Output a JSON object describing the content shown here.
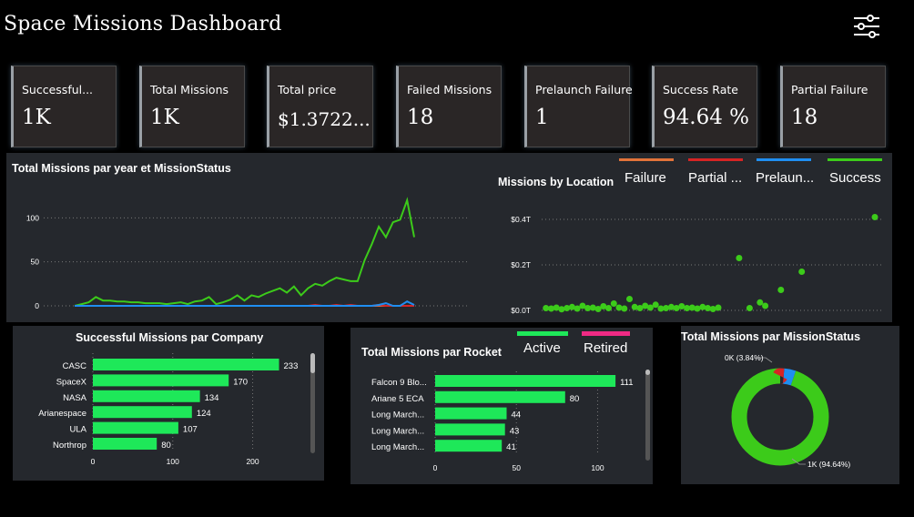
{
  "header": {
    "title": "Space Missions Dashboard",
    "filter_icon": "sliders-icon"
  },
  "kpis": [
    {
      "label": "Successful...",
      "value": "1K"
    },
    {
      "label": "Total Missions",
      "value": "1K"
    },
    {
      "label": "Total price",
      "value": "$1.3722..."
    },
    {
      "label": "Failed Missions",
      "value": "18"
    },
    {
      "label": "Prelaunch Failure",
      "value": "1"
    },
    {
      "label": "Success Rate",
      "value": "94.64 %"
    },
    {
      "label": "Partial Failure",
      "value": "18"
    }
  ],
  "status_legend": [
    {
      "label": "Failure",
      "color": "#e2733a"
    },
    {
      "label": "Partial ...",
      "color": "#d62424"
    },
    {
      "label": "Prelaun...",
      "color": "#1f8ef1"
    },
    {
      "label": "Success",
      "color": "#3ccb1a"
    }
  ],
  "rocket_legend": [
    {
      "label": "Active",
      "color": "#1ee859"
    },
    {
      "label": "Retired",
      "color": "#ef2a84"
    }
  ],
  "line_panel": {
    "title": "Total Missions par year et MissionStatus"
  },
  "location_panel": {
    "title": "Missions by Location"
  },
  "company_panel": {
    "title": "Successful Missions par Company"
  },
  "rocket_panel": {
    "title": "Total Missions par Rocket"
  },
  "status_panel": {
    "title": "Total Missions par MissionStatus"
  },
  "chart_data": [
    {
      "type": "line",
      "title": "Total Missions par year et MissionStatus",
      "ylim": [
        0,
        120
      ],
      "yticks": [
        0,
        50,
        100
      ],
      "grid": true,
      "x": [
        1,
        2,
        3,
        4,
        5,
        6,
        7,
        8,
        9,
        10,
        11,
        12,
        13,
        14,
        15,
        16,
        17,
        18,
        19,
        20,
        21,
        22,
        23,
        24,
        25,
        26,
        27,
        28,
        29,
        30,
        31,
        32,
        33,
        34,
        35,
        36,
        37,
        38,
        39,
        40,
        41,
        42,
        43,
        44,
        45
      ],
      "series": [
        {
          "name": "Success",
          "color": "#3ccb1a",
          "values": [
            0,
            2,
            4,
            10,
            6,
            6,
            5,
            5,
            4,
            4,
            3,
            3,
            3,
            2,
            3,
            4,
            2,
            5,
            6,
            10,
            2,
            4,
            7,
            12,
            6,
            12,
            10,
            14,
            17,
            20,
            15,
            22,
            12,
            20,
            25,
            23,
            28,
            32,
            30,
            28,
            28,
            52,
            70,
            90,
            78,
            95,
            98,
            120,
            78
          ]
        },
        {
          "name": "Failure",
          "color": "#e2733a",
          "values": [
            0,
            0,
            0,
            0,
            0,
            0,
            0,
            0,
            0,
            0,
            0,
            0,
            0,
            0,
            0,
            0,
            0,
            0,
            0,
            0,
            0,
            0,
            0,
            0,
            0,
            0,
            0,
            0,
            0,
            0,
            0,
            0,
            0,
            0,
            0,
            0,
            0,
            0,
            0,
            0,
            0,
            0,
            0,
            0,
            0,
            0,
            0,
            0,
            0
          ]
        },
        {
          "name": "Partial ...",
          "color": "#d62424",
          "values": [
            0,
            0,
            0,
            0,
            0,
            0,
            0,
            0,
            0,
            0,
            0,
            0,
            0,
            0,
            0,
            0,
            0,
            0,
            0,
            0,
            0,
            0,
            0,
            0,
            0,
            0,
            0,
            0,
            0,
            0,
            0,
            0,
            0,
            0,
            1,
            0,
            0,
            1,
            0,
            1,
            0,
            0,
            0,
            1,
            0,
            0,
            0,
            0,
            0
          ]
        },
        {
          "name": "Prelaun...",
          "color": "#1f8ef1",
          "values": [
            0,
            0,
            0,
            0,
            0,
            0,
            0,
            0,
            0,
            0,
            0,
            0,
            0,
            0,
            0,
            0,
            0,
            0,
            0,
            0,
            0,
            0,
            0,
            0,
            0,
            0,
            0,
            0,
            0,
            0,
            0,
            0,
            0,
            0,
            0,
            0,
            0,
            0,
            0,
            0,
            0,
            0,
            0,
            1,
            3,
            0,
            0,
            5,
            1
          ]
        }
      ]
    },
    {
      "type": "scatter",
      "title": "Missions by Location",
      "ylim": [
        0,
        0.45
      ],
      "yticks": [
        {
          "value": 0,
          "label": "$0.0T"
        },
        {
          "value": 0.2,
          "label": "$0.2T"
        },
        {
          "value": 0.4,
          "label": "$0.4T"
        }
      ],
      "color": "#3ccb1a",
      "points": [
        [
          1,
          0.01
        ],
        [
          2,
          0.008
        ],
        [
          3,
          0.012
        ],
        [
          4,
          0.005
        ],
        [
          5,
          0.01
        ],
        [
          6,
          0.015
        ],
        [
          7,
          0.008
        ],
        [
          8,
          0.02
        ],
        [
          9,
          0.01
        ],
        [
          10,
          0.012
        ],
        [
          11,
          0.006
        ],
        [
          12,
          0.018
        ],
        [
          13,
          0.01
        ],
        [
          14,
          0.03
        ],
        [
          15,
          0.012
        ],
        [
          16,
          0.008
        ],
        [
          17,
          0.05
        ],
        [
          18,
          0.015
        ],
        [
          19,
          0.01
        ],
        [
          20,
          0.02
        ],
        [
          21,
          0.012
        ],
        [
          22,
          0.025
        ],
        [
          23,
          0.008
        ],
        [
          24,
          0.01
        ],
        [
          25,
          0.015
        ],
        [
          26,
          0.01
        ],
        [
          27,
          0.018
        ],
        [
          28,
          0.01
        ],
        [
          29,
          0.012
        ],
        [
          30,
          0.008
        ],
        [
          31,
          0.015
        ],
        [
          32,
          0.01
        ],
        [
          33,
          0.006
        ],
        [
          34,
          0.012
        ],
        [
          38,
          0.23
        ],
        [
          40,
          0.01
        ],
        [
          42,
          0.035
        ],
        [
          43,
          0.02
        ],
        [
          46,
          0.09
        ],
        [
          50,
          0.17
        ],
        [
          64,
          0.41
        ]
      ]
    },
    {
      "type": "bar",
      "title": "Successful Missions par Company",
      "orientation": "horizontal",
      "color": "#1ee859",
      "categories": [
        "CASC",
        "SpaceX",
        "NASA",
        "Arianespace",
        "ULA",
        "Northrop"
      ],
      "values": [
        233,
        170,
        134,
        124,
        107,
        80
      ],
      "xlim": [
        0,
        270
      ],
      "xticks": [
        0,
        100,
        200
      ],
      "grid": true
    },
    {
      "type": "bar",
      "title": "Total Missions par Rocket",
      "orientation": "horizontal",
      "color": "#1ee859",
      "categories": [
        "Falcon 9 Blo...",
        "Ariane 5 ECA",
        "Long March...",
        "Long March...",
        "Long March..."
      ],
      "values": [
        111,
        80,
        44,
        43,
        41
      ],
      "xlim": [
        0,
        130
      ],
      "xticks": [
        0,
        50,
        100
      ],
      "grid": true
    },
    {
      "type": "pie",
      "title": "Total Missions par MissionStatus",
      "donut": true,
      "slices": [
        {
          "label": "1K (94.64%)",
          "value": 94.64,
          "color": "#3ccb1a"
        },
        {
          "label": "0K (3.84%)",
          "value": 3.84,
          "color": "#1f8ef1"
        },
        {
          "label": "",
          "value": 1.52,
          "color": "#d62424"
        }
      ]
    }
  ]
}
